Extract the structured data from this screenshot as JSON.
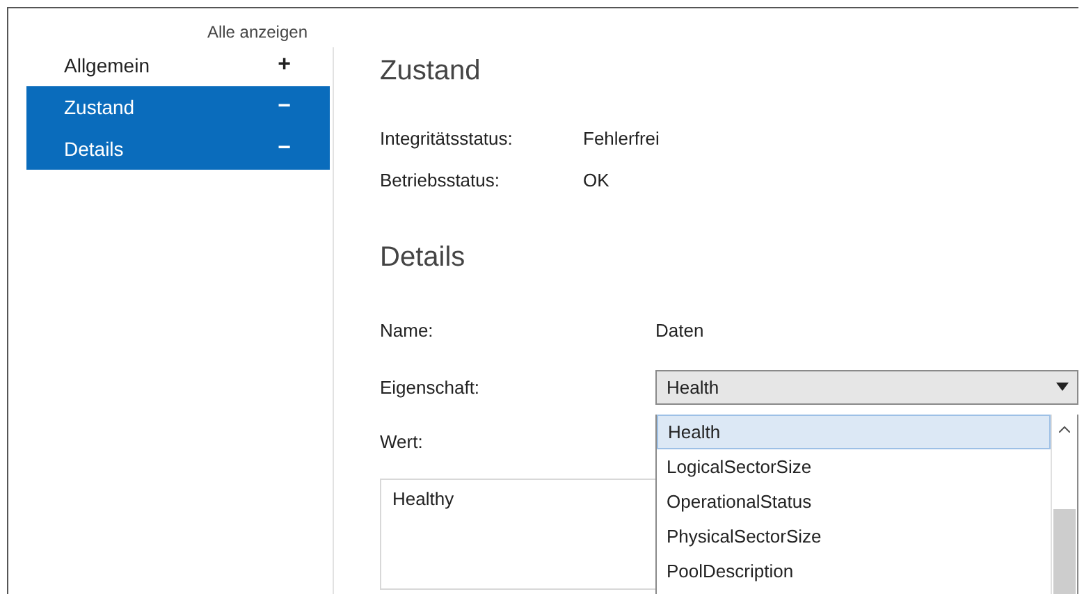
{
  "sidebar": {
    "show_all": "Alle anzeigen",
    "items": [
      {
        "label": "Allgemein",
        "symbol": "+",
        "selected": false
      },
      {
        "label": "Zustand",
        "symbol": "−",
        "selected": true
      },
      {
        "label": "Details",
        "symbol": "−",
        "selected": true
      }
    ]
  },
  "health": {
    "title": "Zustand",
    "fields": [
      {
        "label": "Integritätsstatus:",
        "value": "Fehlerfrei"
      },
      {
        "label": "Betriebsstatus:",
        "value": "OK"
      }
    ]
  },
  "details": {
    "title": "Details",
    "name": {
      "label": "Name:",
      "value": "Daten"
    },
    "property": {
      "label": "Eigenschaft:",
      "value": "Health",
      "options": [
        {
          "label": "Health",
          "selected": true
        },
        {
          "label": "LogicalSectorSize",
          "selected": false
        },
        {
          "label": "OperationalStatus",
          "selected": false
        },
        {
          "label": "PhysicalSectorSize",
          "selected": false
        },
        {
          "label": "PoolDescription",
          "selected": false
        }
      ]
    },
    "value": {
      "label": "Wert:",
      "value": "Healthy"
    }
  }
}
